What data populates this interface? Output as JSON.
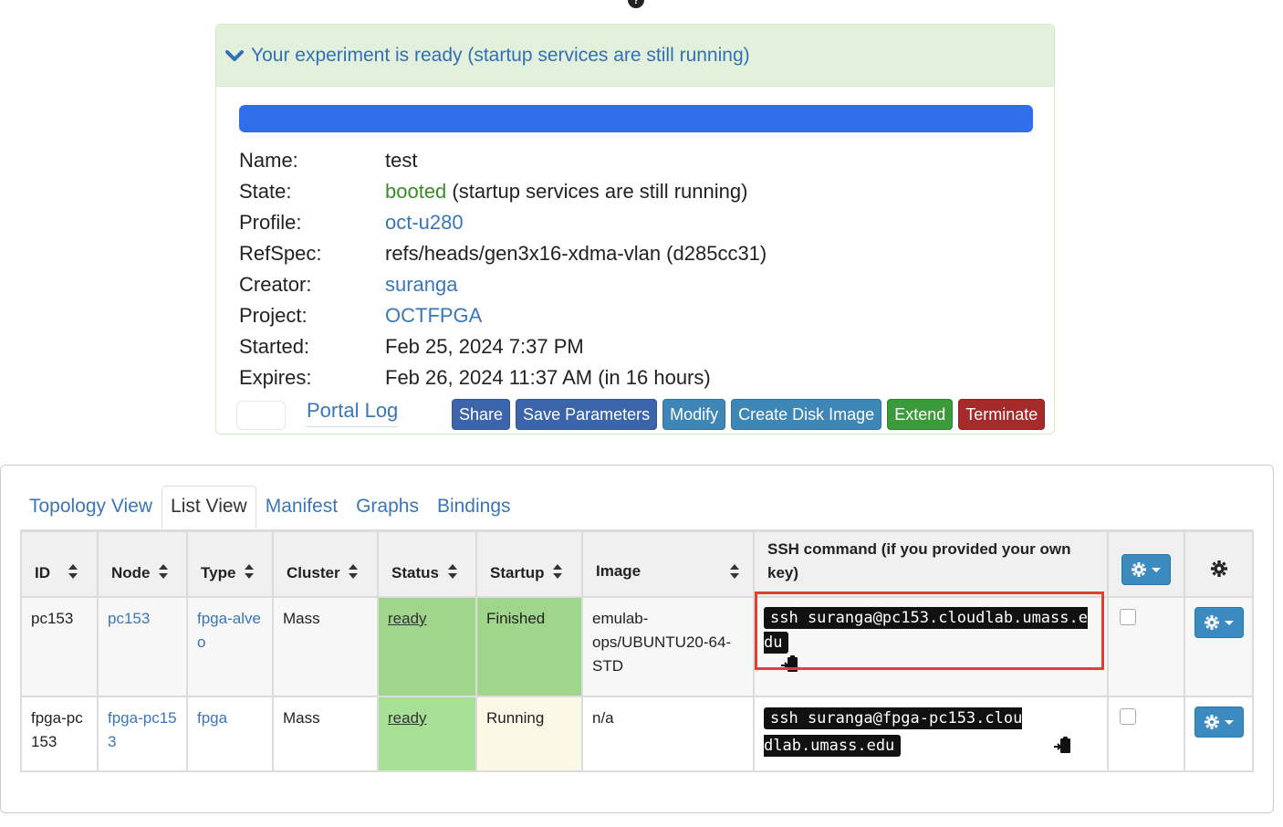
{
  "panel": {
    "title": "Your experiment is ready (startup services are still running)",
    "progress_percent": 100,
    "info": {
      "name_label": "Name:",
      "name_value": "test",
      "state_label": "State:",
      "state_value": "booted",
      "state_suffix": " (startup services are still running)",
      "profile_label": "Profile:",
      "profile_value": "oct-u280",
      "refspec_label": "RefSpec:",
      "refspec_value": "refs/heads/gen3x16-xdma-vlan (d285cc31)",
      "creator_label": "Creator:",
      "creator_value": "suranga",
      "project_label": "Project:",
      "project_value": "OCTFPGA",
      "started_label": "Started:",
      "started_value": "Feb 25, 2024 7:37 PM",
      "expires_label": "Expires:",
      "expires_value": "Feb 26, 2024 11:37 AM (in 16 hours)"
    },
    "portal_log": "Portal Log",
    "buttons": {
      "share": "Share",
      "save_parameters": "Save Parameters",
      "modify": "Modify",
      "create_disk_image": "Create Disk Image",
      "extend": "Extend",
      "terminate": "Terminate"
    }
  },
  "tabs": [
    "Topology View",
    "List View",
    "Manifest",
    "Graphs",
    "Bindings"
  ],
  "active_tab": "List View",
  "table": {
    "headers": {
      "id": "ID",
      "node": "Node",
      "type": "Type",
      "cluster": "Cluster",
      "status": "Status",
      "startup": "Startup",
      "image": "Image",
      "ssh": "SSH command (if you provided your own key)"
    },
    "rows": [
      {
        "id": "pc153",
        "node": "pc153",
        "type": "fpga-alveo",
        "cluster": "Mass",
        "status": "ready",
        "startup": "Finished",
        "image": "emulab-ops/UBUNTU20-64-STD",
        "ssh": "ssh suranga@pc153.cloudlab.umass.edu"
      },
      {
        "id": "fpga-pc153",
        "node": "fpga-pc153",
        "type": "fpga",
        "cluster": "Mass",
        "status": "ready",
        "startup": "Running",
        "image": "n/a",
        "ssh": "ssh suranga@fpga-pc153.cloudlab.umass.edu"
      }
    ]
  },
  "colors": {
    "link": "#3a76b8",
    "progress": "#2f6ee8",
    "ready": "#9fd68c",
    "running": "#fbf8e8",
    "highlight": "#e04030"
  }
}
